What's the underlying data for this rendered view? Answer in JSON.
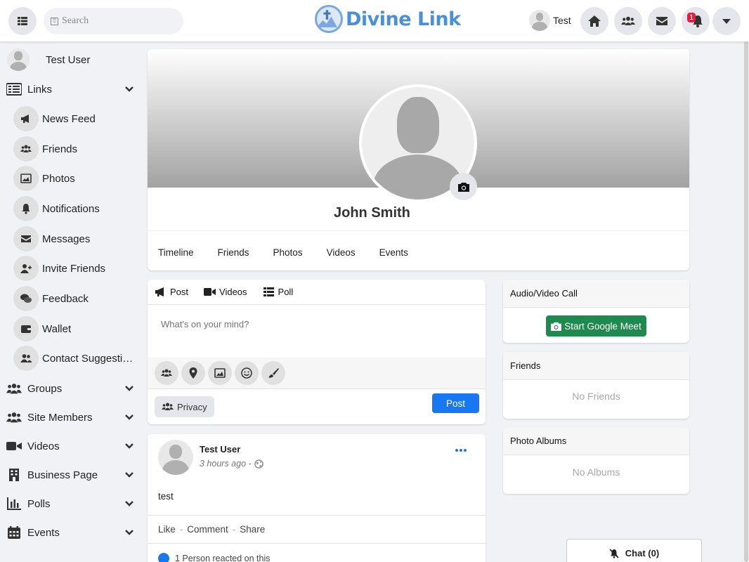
{
  "header": {
    "search_placeholder": "Search",
    "brand": "Divine Link",
    "user_name": "Test",
    "notification_count": "1",
    "icons": [
      "grid-icon",
      "home-icon",
      "users-icon",
      "envelope-icon",
      "bell-icon",
      "caret-down-icon"
    ]
  },
  "sidebar": {
    "user_name": "Test User",
    "links_label": "Links",
    "link_items": [
      {
        "label": "News Feed",
        "icon": "bullhorn-icon"
      },
      {
        "label": "Friends",
        "icon": "users-icon"
      },
      {
        "label": "Photos",
        "icon": "image-icon"
      },
      {
        "label": "Notifications",
        "icon": "bell-icon"
      },
      {
        "label": "Messages",
        "icon": "envelope-icon"
      },
      {
        "label": "Invite Friends",
        "icon": "user-plus-icon"
      },
      {
        "label": "Feedback",
        "icon": "comments-icon"
      },
      {
        "label": "Wallet",
        "icon": "wallet-icon"
      },
      {
        "label": "Contact Suggestions",
        "icon": "user-friends-icon"
      }
    ],
    "sections": [
      {
        "label": "Groups",
        "icon": "users-icon"
      },
      {
        "label": "Site Members",
        "icon": "users-icon"
      },
      {
        "label": "Videos",
        "icon": "video-icon"
      },
      {
        "label": "Business Page",
        "icon": "building-icon"
      },
      {
        "label": "Polls",
        "icon": "chart-icon"
      },
      {
        "label": "Events",
        "icon": "calendar-icon"
      }
    ]
  },
  "profile": {
    "name": "John Smith",
    "tabs": [
      "Timeline",
      "Friends",
      "Photos",
      "Videos",
      "Events"
    ]
  },
  "composer": {
    "tabs": [
      {
        "label": "Post",
        "icon": "bullhorn-icon"
      },
      {
        "label": "Videos",
        "icon": "video-icon"
      },
      {
        "label": "Poll",
        "icon": "list-icon"
      }
    ],
    "placeholder": "What's on your mind?",
    "tools": [
      "tag-friends-icon",
      "location-icon",
      "image-icon",
      "emoji-icon",
      "brush-icon"
    ],
    "privacy_label": "Privacy",
    "post_label": "Post"
  },
  "post": {
    "author": "Test User",
    "time": "3 hours ago",
    "time_sep": "-",
    "body": "test",
    "actions": [
      "Like",
      "Comment",
      "Share"
    ],
    "reactions": "1 Person reacted on this"
  },
  "right": {
    "call_title": "Audio/Video Call",
    "meet_label": "Start Google Meet",
    "friends_title": "Friends",
    "friends_empty": "No Friends",
    "albums_title": "Photo Albums",
    "albums_empty": "No Albums"
  },
  "chat": {
    "label": "Chat (0)"
  },
  "colors": {
    "primary": "#1877f2",
    "meet_green": "#1d8a4e",
    "brand_blue": "#4a90d9",
    "badge_red": "#e41e3f"
  }
}
